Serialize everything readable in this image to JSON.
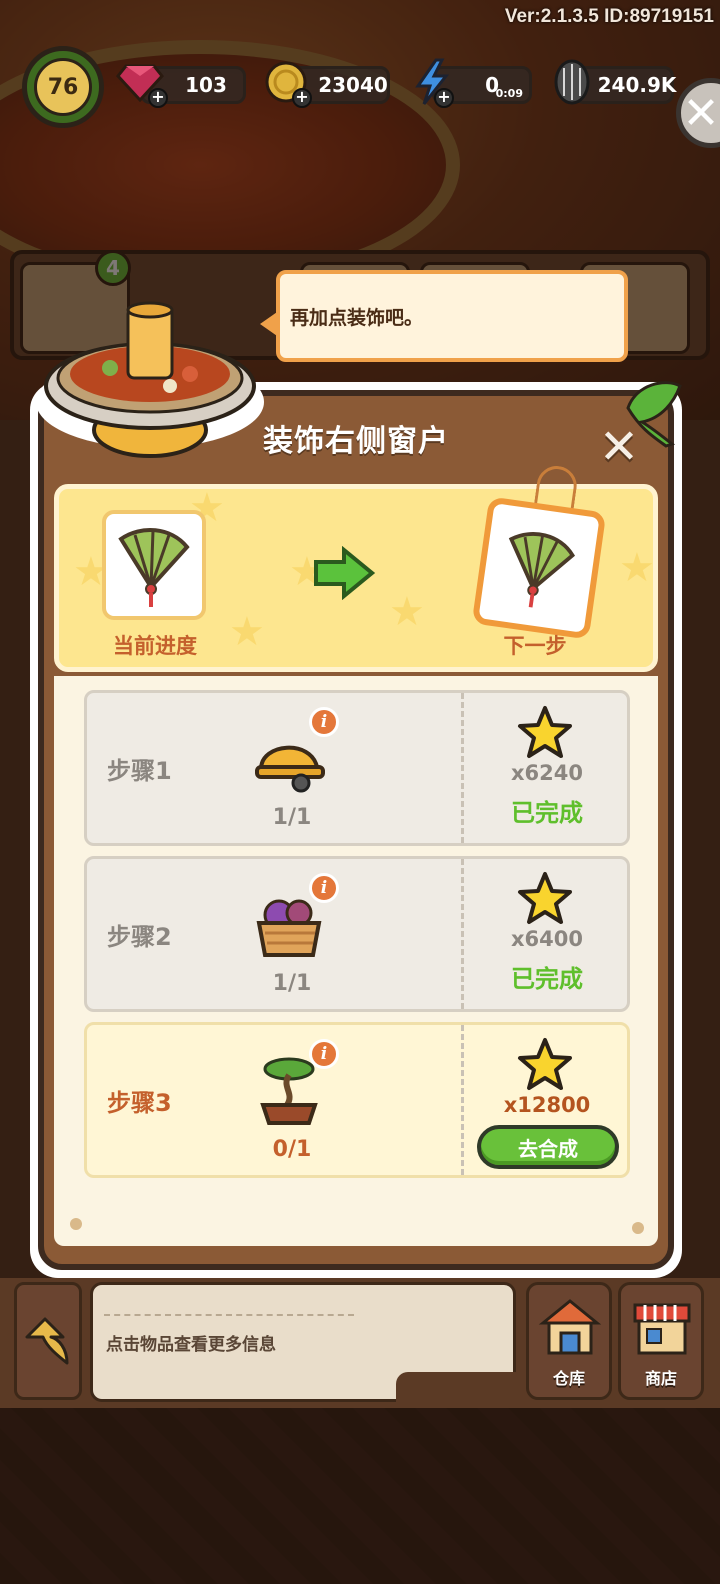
{
  "hud": {
    "version": "Ver:2.1.3.5 ID:89719151",
    "level": "76",
    "gems": "103",
    "coins": "23040",
    "energy": "0",
    "energy_timer": "0:09",
    "seeds": "240.9K"
  },
  "shelf": {
    "badge": "4"
  },
  "bubble": {
    "text": "再加点装饰吧。"
  },
  "modal": {
    "title": "装饰右侧窗户",
    "current_label": "当前进度",
    "next_label": "下一步",
    "steps": [
      {
        "label": "步骤1",
        "count": "1/1",
        "reward": "x6240",
        "status": "已完成",
        "icon": "hard-hat-icon"
      },
      {
        "label": "步骤2",
        "count": "1/1",
        "reward": "x6400",
        "status": "已完成",
        "icon": "yarn-basket-icon"
      },
      {
        "label": "步骤3",
        "count": "0/1",
        "reward": "x12800",
        "action": "去合成",
        "icon": "bonsai-icon"
      }
    ]
  },
  "bottom": {
    "info_text": "点击物品查看更多信息",
    "warehouse": "仓库",
    "shop": "商店"
  },
  "colors": {
    "accent_orange": "#c4602c",
    "done_green": "#5fbf2c",
    "modal_brown": "#8b5a36",
    "progress_yellow": "#fde68f"
  }
}
